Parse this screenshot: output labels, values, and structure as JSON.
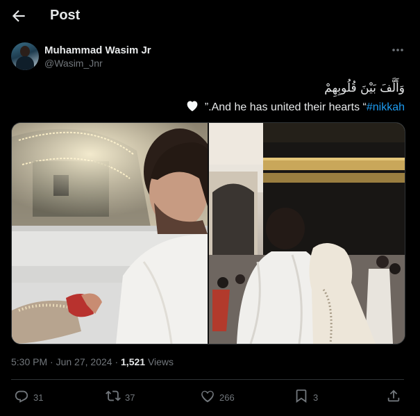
{
  "header": {
    "title": "Post"
  },
  "author": {
    "name": "Muhammad Wasim Jr",
    "handle": "@Wasim_Jnr"
  },
  "tweet": {
    "arabic": "وَأَلَّفَ بَيْنَ قُلُوبِهِمْ",
    "text": "”.And he has united their hearts “",
    "hashtag": "#nikkah"
  },
  "meta": {
    "time": "5:30 PM",
    "separator1": "·",
    "date": "Jun 27, 2024",
    "separator2": "·",
    "views_count": "1,521",
    "views_label": "Views"
  },
  "actions": {
    "replies": "31",
    "reposts": "37",
    "likes": "266",
    "bookmarks": "3"
  },
  "icons": [
    "back-arrow-icon",
    "more-icon",
    "white-heart-icon",
    "reply-icon",
    "repost-icon",
    "like-icon",
    "bookmark-icon",
    "share-icon"
  ],
  "colors": {
    "background": "#000000",
    "text": "#e7e9ea",
    "muted": "#71767b",
    "link": "#1d9bf0",
    "border": "#2f3336"
  }
}
